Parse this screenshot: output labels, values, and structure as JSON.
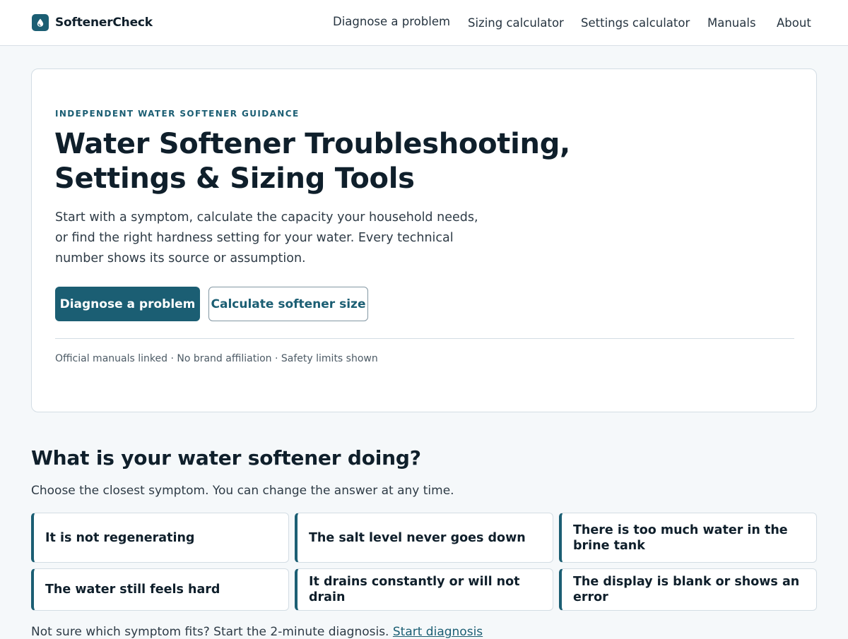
{
  "header": {
    "brand_name": "SoftenerCheck",
    "brand_icon": "droplet-icon",
    "nav": [
      {
        "label": "Diagnose a problem"
      },
      {
        "label": "Sizing calculator"
      },
      {
        "label": "Settings calculator"
      },
      {
        "label": "Manuals"
      },
      {
        "label": "About"
      }
    ]
  },
  "hero": {
    "eyebrow": "INDEPENDENT WATER SOFTENER GUIDANCE",
    "title_line1": "Water Softener Troubleshooting,",
    "title_line2": "Settings & Sizing Tools",
    "subtitle": "Start with a symptom, calculate the capacity your household needs, or find the right hardness setting for your water. Every technical number shows its source or assumption.",
    "primary_button": "Diagnose a problem",
    "secondary_button": "Calculate softener size",
    "trust_line": "Official manuals linked · No brand affiliation · Safety limits shown"
  },
  "symptoms": {
    "title": "What is your water softener doing?",
    "subtitle": "Choose the closest symptom. You can change the answer at any time.",
    "items": [
      {
        "label": "It is not regenerating"
      },
      {
        "label": "The salt level never goes down"
      },
      {
        "label": "There is too much water in the brine tank"
      },
      {
        "label": "The water still feels hard"
      },
      {
        "label": "It drains constantly or will not drain"
      },
      {
        "label": "The display is blank or shows an error"
      }
    ],
    "footer_text": "Not sure which symptom fits? Start the 2-minute diagnosis.",
    "footer_link": "Start diagnosis"
  },
  "colors": {
    "accent": "#1b5e73",
    "page_background": "#f5f8fa",
    "card_border": "#d3dde4",
    "text_primary": "#0f1f2b"
  }
}
